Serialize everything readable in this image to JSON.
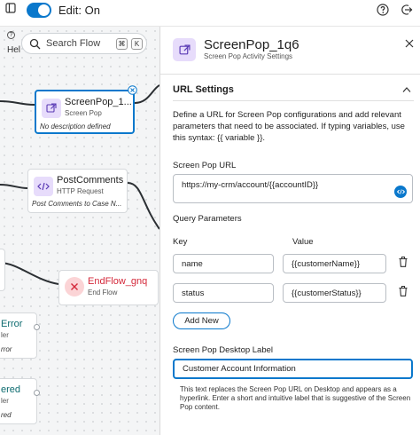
{
  "topbar": {
    "edit_label": "Edit: On",
    "toggle_on": true
  },
  "canvas": {
    "help_label": "Hel",
    "search_placeholder": "Search Flow",
    "shortcut_keys": [
      "⌘",
      "K"
    ],
    "nodes": [
      {
        "title": "ScreenPop_1...",
        "subtitle": "Screen Pop",
        "description": "No description defined",
        "icon": "screen-pop-icon"
      },
      {
        "title": "PostComments",
        "subtitle": "HTTP Request",
        "description": "Post Comments to Case N...",
        "icon": "http-request-icon"
      },
      {
        "title": "EndFlow_gnq",
        "subtitle": "End Flow",
        "icon": "end-flow-icon"
      },
      {
        "title": "Error",
        "subtitle": "ler",
        "description": "rror"
      },
      {
        "title": "ered",
        "subtitle": "ler",
        "description": "red"
      }
    ]
  },
  "panel": {
    "title": "ScreenPop_1q6",
    "subtitle": "Screen Pop Activity Settings",
    "section_title": "URL Settings",
    "description": "Define a URL for Screen Pop configurations and add relevant parameters that need to be associated. If typing variables, use this syntax: {{ variable }}.",
    "url_label": "Screen Pop URL",
    "url_value": "https://my-crm/account/{{accountID}}",
    "query_label": "Query Parameters",
    "key_header": "Key",
    "value_header": "Value",
    "params": [
      {
        "key": "name",
        "value": "{{customerName}}"
      },
      {
        "key": "status",
        "value": "{{customerStatus}}"
      }
    ],
    "add_button": "Add New",
    "desktop_label": "Screen Pop Desktop Label",
    "desktop_value": "Customer Account Information",
    "help_text": "This text replaces the Screen Pop URL on Desktop and appears as a hyperlink. Enter a short and intuitive label that is suggestive of the Screen Pop content."
  },
  "colors": {
    "accent": "#0a78cc",
    "screen_pop_icon_bg": "#e7dcfb",
    "end_flow_icon_bg": "#fbd4d6",
    "end_flow_accent": "#d4283a",
    "canvas_bg": "#f4f5f6"
  }
}
